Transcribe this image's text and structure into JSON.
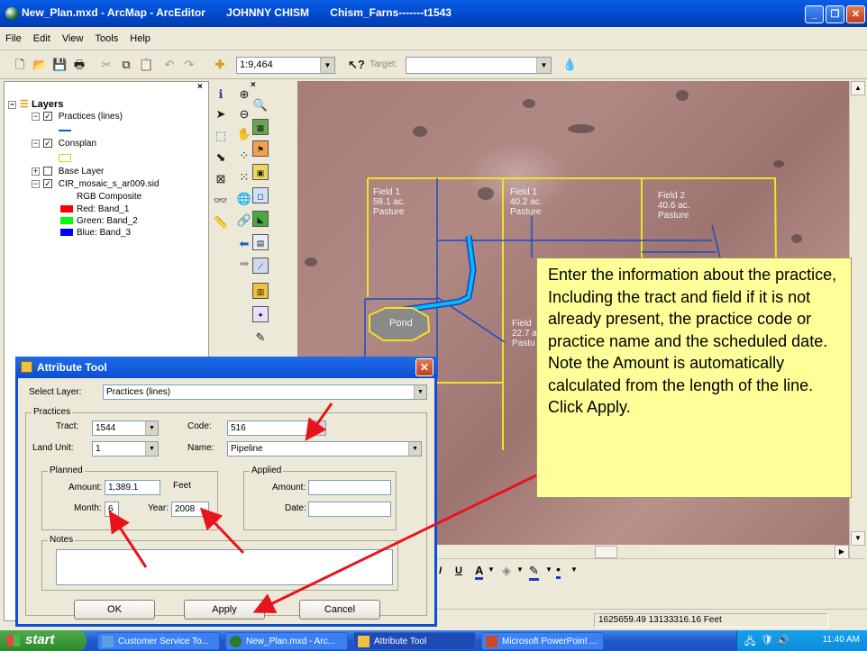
{
  "window": {
    "title": "New_Plan.mxd - ArcMap - ArcEditor       JOHNNY CHISM       Chism_Farns-------t1543",
    "minimize": "_",
    "restore": "❐",
    "close": "✕"
  },
  "menu": [
    "File",
    "Edit",
    "View",
    "Tools",
    "Help"
  ],
  "toolbar": {
    "scale": "1:9,464",
    "target_label": "Target:",
    "target_value": ""
  },
  "toc": {
    "root": "Layers",
    "layers": [
      {
        "name": "Practices (lines)",
        "checked": true
      },
      {
        "name": "Consplan",
        "checked": true
      },
      {
        "name": "Base Layer",
        "checked": false
      },
      {
        "name": "CIR_mosaic_s_ar009.sid",
        "checked": true
      }
    ],
    "rgb_label": "RGB Composite",
    "bands": [
      {
        "label": "Red:   Band_1",
        "color": "#ff0000"
      },
      {
        "label": "Green: Band_2",
        "color": "#00ff00"
      },
      {
        "label": "Blue:  Band_3",
        "color": "#0000ff"
      }
    ]
  },
  "map": {
    "fields": [
      {
        "lines": [
          "Field  1",
          "58.1 ac.",
          "Pasture"
        ]
      },
      {
        "lines": [
          "Field  1",
          "40.2 ac.",
          "Pasture"
        ]
      },
      {
        "lines": [
          "Field  2",
          "40.6 ac.",
          "Pasture"
        ]
      },
      {
        "lines": [
          "Field",
          "22.7 a",
          "Pastu"
        ]
      }
    ],
    "pond_label": "Pond",
    "line_color": "#00bfff",
    "field_color": "#f2e02a"
  },
  "callout": {
    "text": "Enter the information about the practice, Including the tract and field if it is not already present, the practice code or practice name and the scheduled date. Note the Amount is automatically calculated from the length of the line. Click Apply."
  },
  "status": {
    "coords": "1625659.49  13133316.16 Feet"
  },
  "dialog": {
    "title": "Attribute Tool",
    "select_layer_label": "Select Layer:",
    "select_layer_value": "Practices (lines)",
    "practices_group": "Practices",
    "tract_label": "Tract:",
    "tract_value": "1544",
    "code_label": "Code:",
    "code_value": "516",
    "land_unit_label": "Land Unit:",
    "land_unit_value": "1",
    "name_label": "Name:",
    "name_value": "Pipeline",
    "planned_group": "Planned",
    "amount_label": "Amount:",
    "amount_value": "1,389.1",
    "feet_label": "Feet",
    "month_label": "Month:",
    "month_value": "6",
    "year_label": "Year:",
    "year_value": "2008",
    "applied_group": "Applied",
    "applied_amount_label": "Amount:",
    "applied_amount_value": "",
    "applied_date_label": "Date:",
    "applied_date_value": "",
    "notes_label": "Notes",
    "notes_value": "",
    "ok": "OK",
    "apply": "Apply",
    "cancel": "Cancel"
  },
  "taskbar": {
    "start": "start",
    "tasks": [
      {
        "label": "Customer Service To...",
        "icon_color": "#5aa0e0"
      },
      {
        "label": "New_Plan.mxd - Arc...",
        "icon_color": "#2b7a2b"
      },
      {
        "label": "Attribute Tool",
        "icon_color": "#f0c040"
      },
      {
        "label": "Microsoft PowerPoint ...",
        "icon_color": "#d24726"
      }
    ],
    "clock": "11:40 AM"
  },
  "annotation_color": "#e8141c"
}
